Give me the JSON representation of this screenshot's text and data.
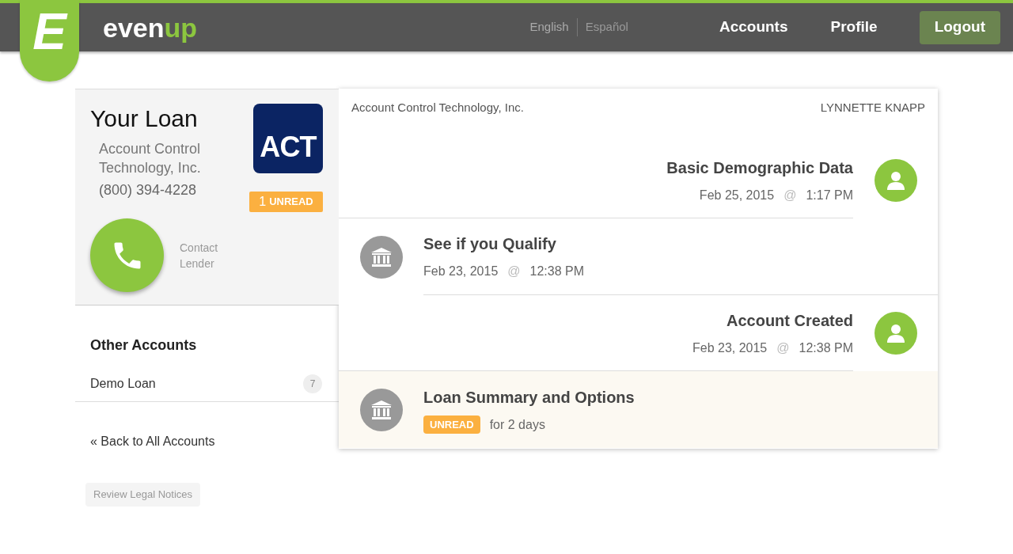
{
  "logo": {
    "letter": "E",
    "brand_start": "even",
    "brand_end": "up"
  },
  "languages": [
    {
      "label": "English",
      "selected": true
    },
    {
      "label": "Español",
      "selected": false
    }
  ],
  "nav": [
    {
      "label": "Accounts",
      "kind": "link"
    },
    {
      "label": "Profile",
      "kind": "link"
    },
    {
      "label": "Logout",
      "kind": "button"
    }
  ],
  "loan": {
    "title": "Your Loan",
    "lender": "Account Control Technology, Inc.",
    "phone": "(800) 394-4228",
    "lender_logo": "ACT",
    "unread_count": "1",
    "unread_label": "UNREAD",
    "contact": "Contact Lender"
  },
  "other_accounts": {
    "title": "Other Accounts",
    "items": [
      {
        "name": "Demo Loan",
        "count": "7"
      }
    ]
  },
  "back_link": {
    "icon": "«",
    "label": "Back to All Accounts"
  },
  "legal_button": "Review Legal Notices",
  "timeline": {
    "lender": "Account Control Technology, Inc.",
    "borrower": "LYNNETTE KNAPP",
    "entries": [
      {
        "kind": "user",
        "title": "Basic Demographic Data",
        "date": "Feb 25, 2015",
        "at": "@",
        "time": "1:17 PM",
        "unread": false
      },
      {
        "kind": "lender",
        "title": "See if you Qualify",
        "date": "Feb 23, 2015",
        "at": "@",
        "time": "12:38 PM",
        "unread": false
      },
      {
        "kind": "user",
        "title": "Account Created",
        "date": "Feb 23, 2015",
        "at": "@",
        "time": "12:38 PM",
        "unread": false
      },
      {
        "kind": "lender",
        "title": "Loan Summary and Options",
        "badge": "UNREAD",
        "duration": "for 2 days",
        "unread": true
      }
    ]
  }
}
